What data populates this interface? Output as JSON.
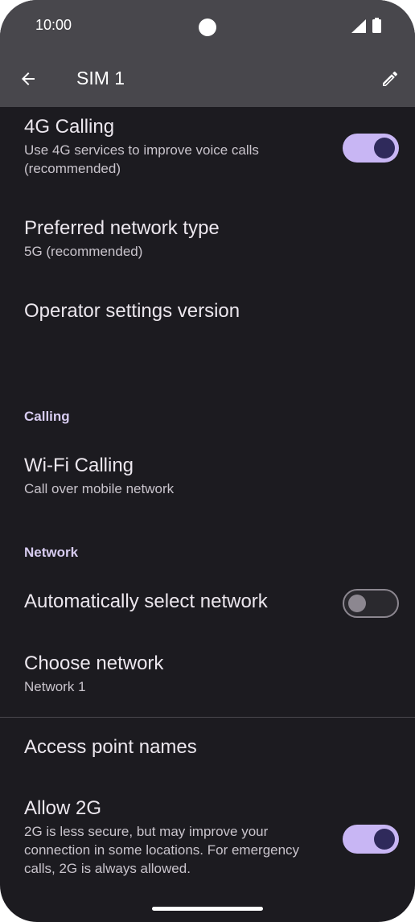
{
  "status": {
    "time": "10:00",
    "icons": [
      "camera-cutout",
      "signal-icon",
      "battery-icon"
    ]
  },
  "appbar": {
    "title": "SIM 1",
    "back_icon": "arrow-back-icon",
    "edit_icon": "edit-pencil-icon"
  },
  "settings": {
    "calling_4g": {
      "title": "4G Calling",
      "subtitle": "Use 4G services to improve voice calls (recommended)",
      "toggle_on": true
    },
    "preferred_network": {
      "title": "Preferred network type",
      "subtitle": "5G (recommended)"
    },
    "operator_version": {
      "title": "Operator settings version"
    },
    "calling_header": "Calling",
    "wifi_calling": {
      "title": "Wi-Fi Calling",
      "subtitle": "Call over mobile network"
    },
    "network_header": "Network",
    "auto_select": {
      "title": "Automatically select network",
      "toggle_on": false
    },
    "choose_network": {
      "title": "Choose network",
      "subtitle": "Network 1"
    },
    "apn": {
      "title": "Access point names"
    },
    "allow_2g": {
      "title": "Allow 2G",
      "subtitle": "2G is less secure, but may improve your connection in some locations. For emergency calls, 2G is always allowed.",
      "toggle_on": true
    }
  },
  "colors": {
    "background": "#1c1b20",
    "appbar": "#48474c",
    "accent": "#c8b6f4",
    "section_header": "#d7ccf0"
  }
}
